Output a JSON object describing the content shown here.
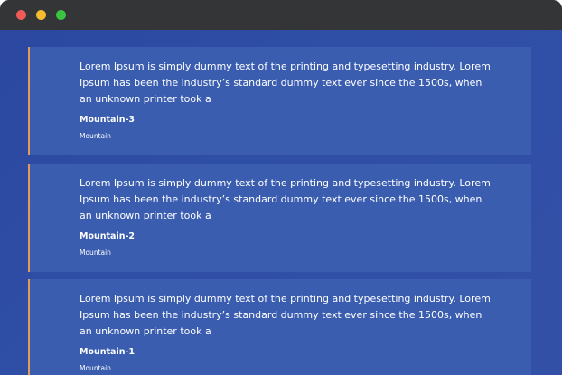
{
  "window": {
    "controls": [
      "close",
      "minimize",
      "maximize"
    ]
  },
  "testimonials": [
    {
      "text": "Lorem Ipsum is simply dummy text of the printing and typesetting industry. Lorem Ipsum has been the industry’s standard dummy text ever since the 1500s, when an unknown printer took a",
      "name": "Mountain-3",
      "role": "Mountain"
    },
    {
      "text": "Lorem Ipsum is simply dummy text of the printing and typesetting industry. Lorem Ipsum has been the industry’s standard dummy text ever since the 1500s, when an unknown printer took a",
      "name": "Mountain-2",
      "role": "Mountain"
    },
    {
      "text": "Lorem Ipsum is simply dummy text of the printing and typesetting industry. Lorem Ipsum has been the industry’s standard dummy text ever since the 1500s, when an unknown printer took a",
      "name": "Mountain-1",
      "role": "Mountain"
    }
  ],
  "colors": {
    "titlebar": "#333536",
    "background": "#2f4ea5",
    "card": "#3a5db0",
    "accent_border": "#e2995a",
    "close": "#ef5956",
    "minimize": "#f6bb2e",
    "maximize": "#3bc43f"
  }
}
